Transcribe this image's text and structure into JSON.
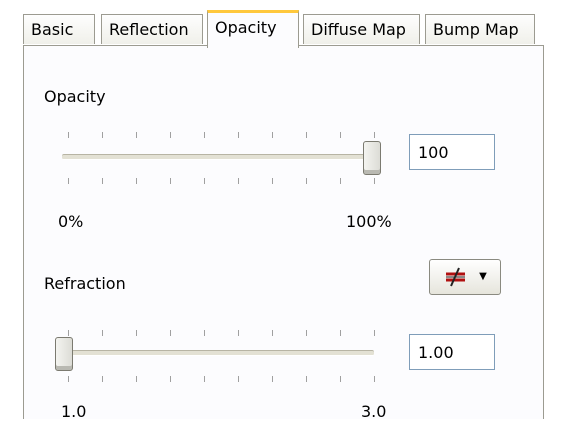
{
  "tabs": [
    {
      "label": "Basic"
    },
    {
      "label": "Reflection"
    },
    {
      "label": "Opacity"
    },
    {
      "label": "Diffuse Map"
    },
    {
      "label": "Bump Map"
    }
  ],
  "opacity": {
    "section_label": "Opacity",
    "value": "100",
    "min_label": "0%",
    "max_label": "100%",
    "slider_fraction": 1.0
  },
  "refraction": {
    "section_label": "Refraction",
    "value": "1.00",
    "min_label": "1.0",
    "max_label": "3.0",
    "slider_fraction": 0.0,
    "preset_button_icon": "refraction-preset-icon"
  },
  "colors": {
    "active_tab_accent": "#ffc83c",
    "border": "#9c9b91",
    "input_border": "#7f9db9"
  }
}
